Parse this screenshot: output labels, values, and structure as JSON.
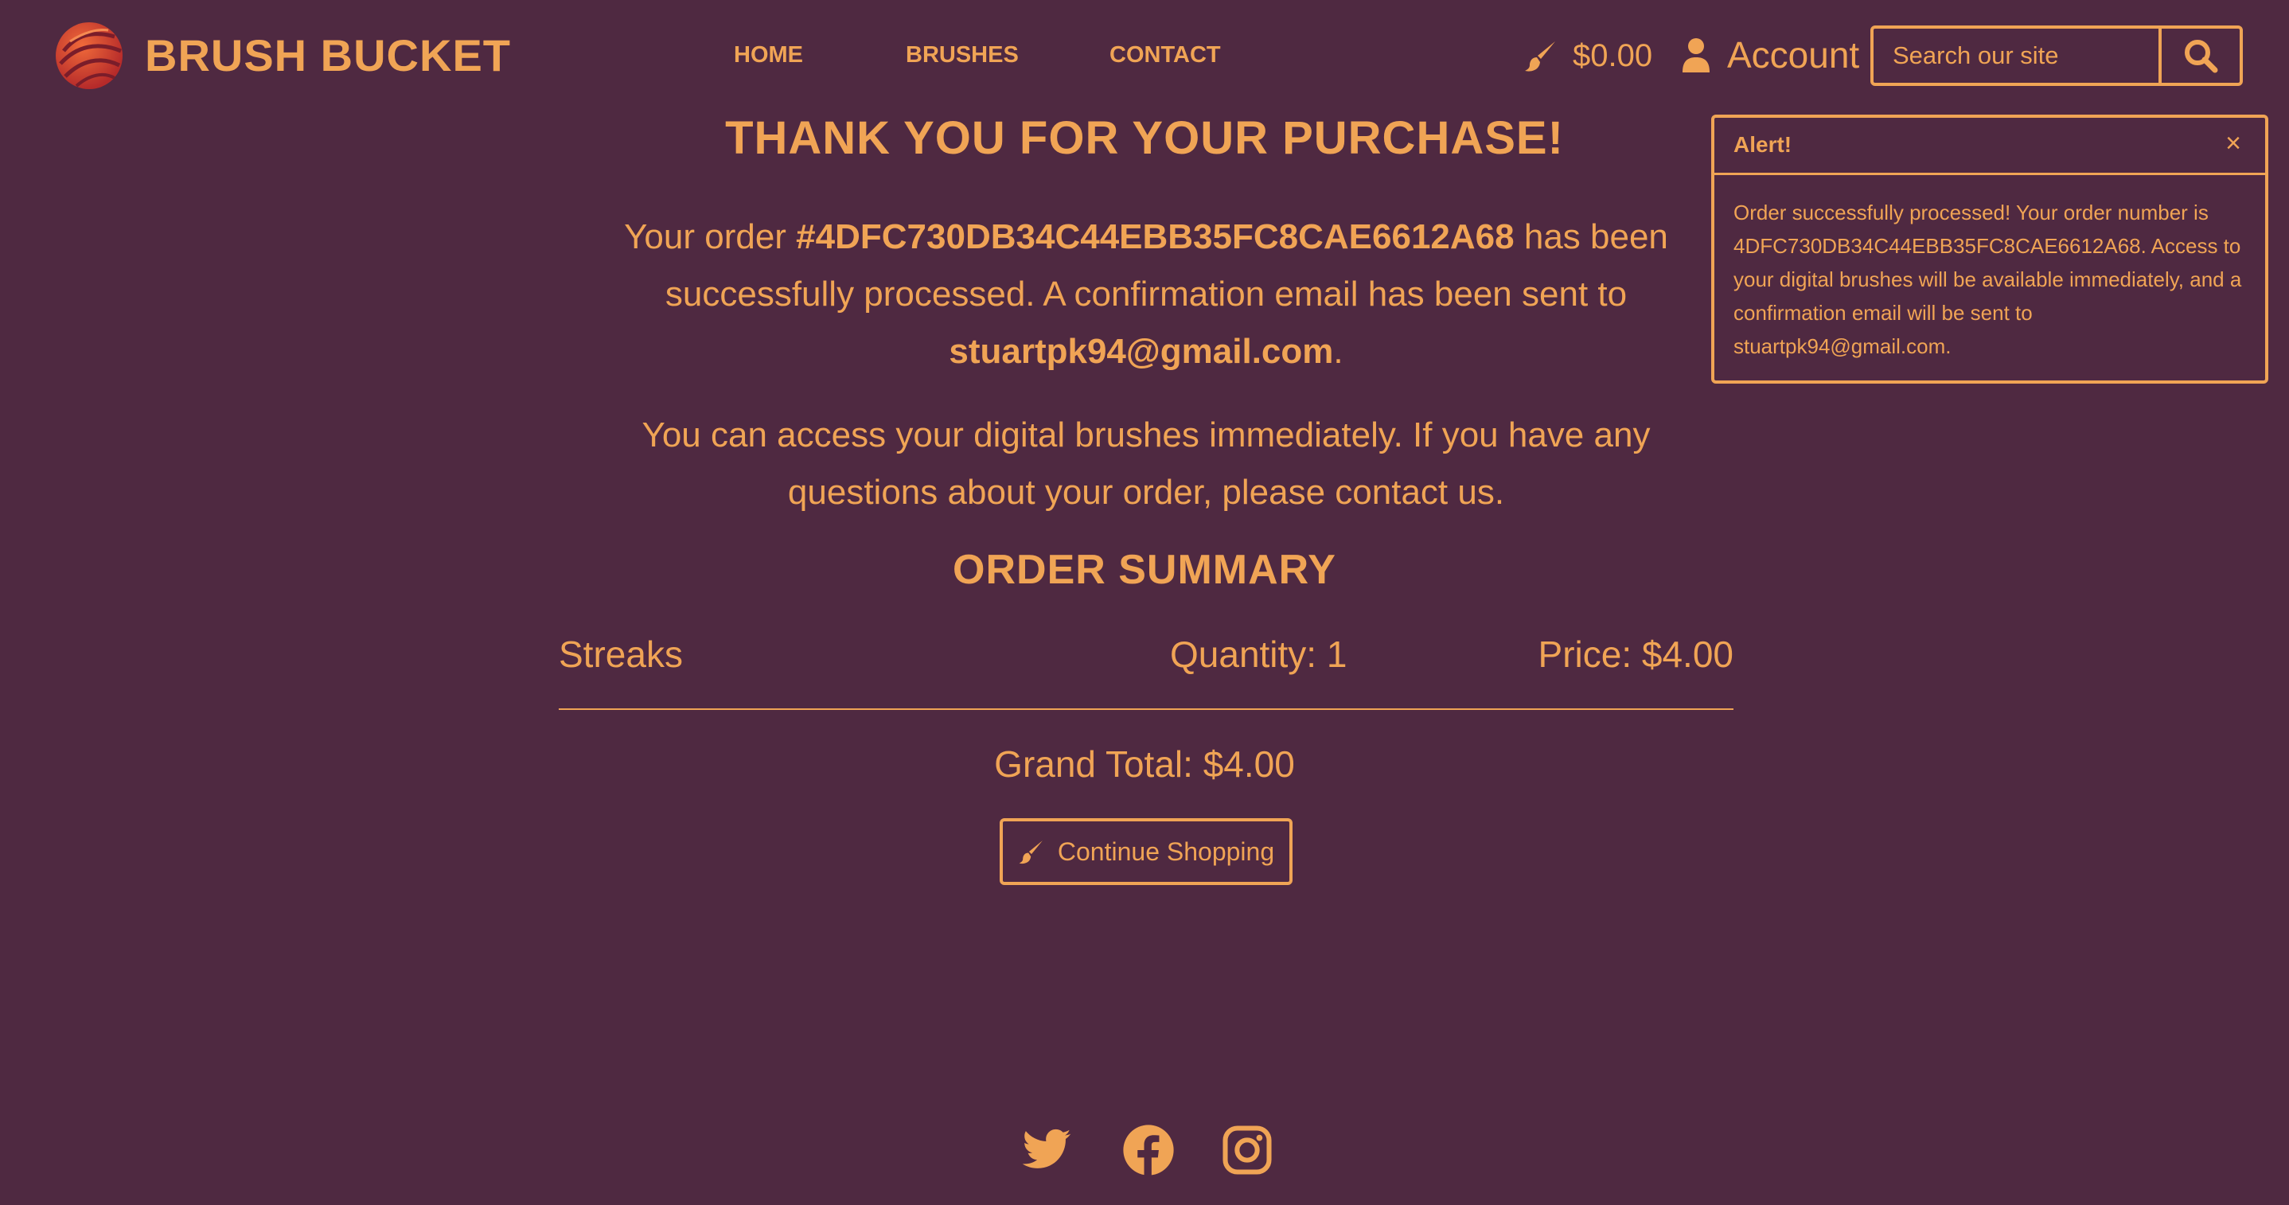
{
  "header": {
    "brand": "BRUSH BUCKET",
    "nav": [
      {
        "label": "HOME"
      },
      {
        "label": "BRUSHES"
      },
      {
        "label": "CONTACT"
      }
    ],
    "cart_total": "$0.00",
    "account_label": "Account",
    "search": {
      "placeholder": "Search our site",
      "value": ""
    }
  },
  "alert": {
    "title": "Alert!",
    "close": "×",
    "message": "Order successfully processed! Your order number is 4DFC730DB34C44EBB35FC8CAE6612A68. Access to your digital brushes will be available immediately, and a confirmation email will be sent to stuartpk94@gmail.com."
  },
  "main": {
    "heading": "THANK YOU FOR YOUR PURCHASE!",
    "p1_prefix": "Your order ",
    "order_number": "#4DFC730DB34C44EBB35FC8CAE6612A68",
    "p1_middle": " has been successfully processed. A confirmation email has been sent to ",
    "email": "stuartpk94@gmail.com",
    "p1_suffix": ".",
    "p2": "You can access your digital brushes immediately. If you have any questions about your order, please contact us.",
    "summary_heading": "ORDER SUMMARY",
    "items": [
      {
        "name": "Streaks",
        "quantity": "Quantity: 1",
        "price": "Price: $4.00"
      }
    ],
    "grand_total": "Grand Total: $4.00",
    "continue_label": "Continue Shopping"
  },
  "icons": {
    "logo": "brush-bucket-logo",
    "cart": "paintbrush-icon",
    "account": "user-icon",
    "search": "search-icon",
    "continue": "paintbrush-icon",
    "social": [
      "twitter-icon",
      "facebook-icon",
      "instagram-icon"
    ]
  },
  "colors": {
    "background": "#4f2941",
    "accent": "#f0a455",
    "logo_red": "#d4382c"
  }
}
